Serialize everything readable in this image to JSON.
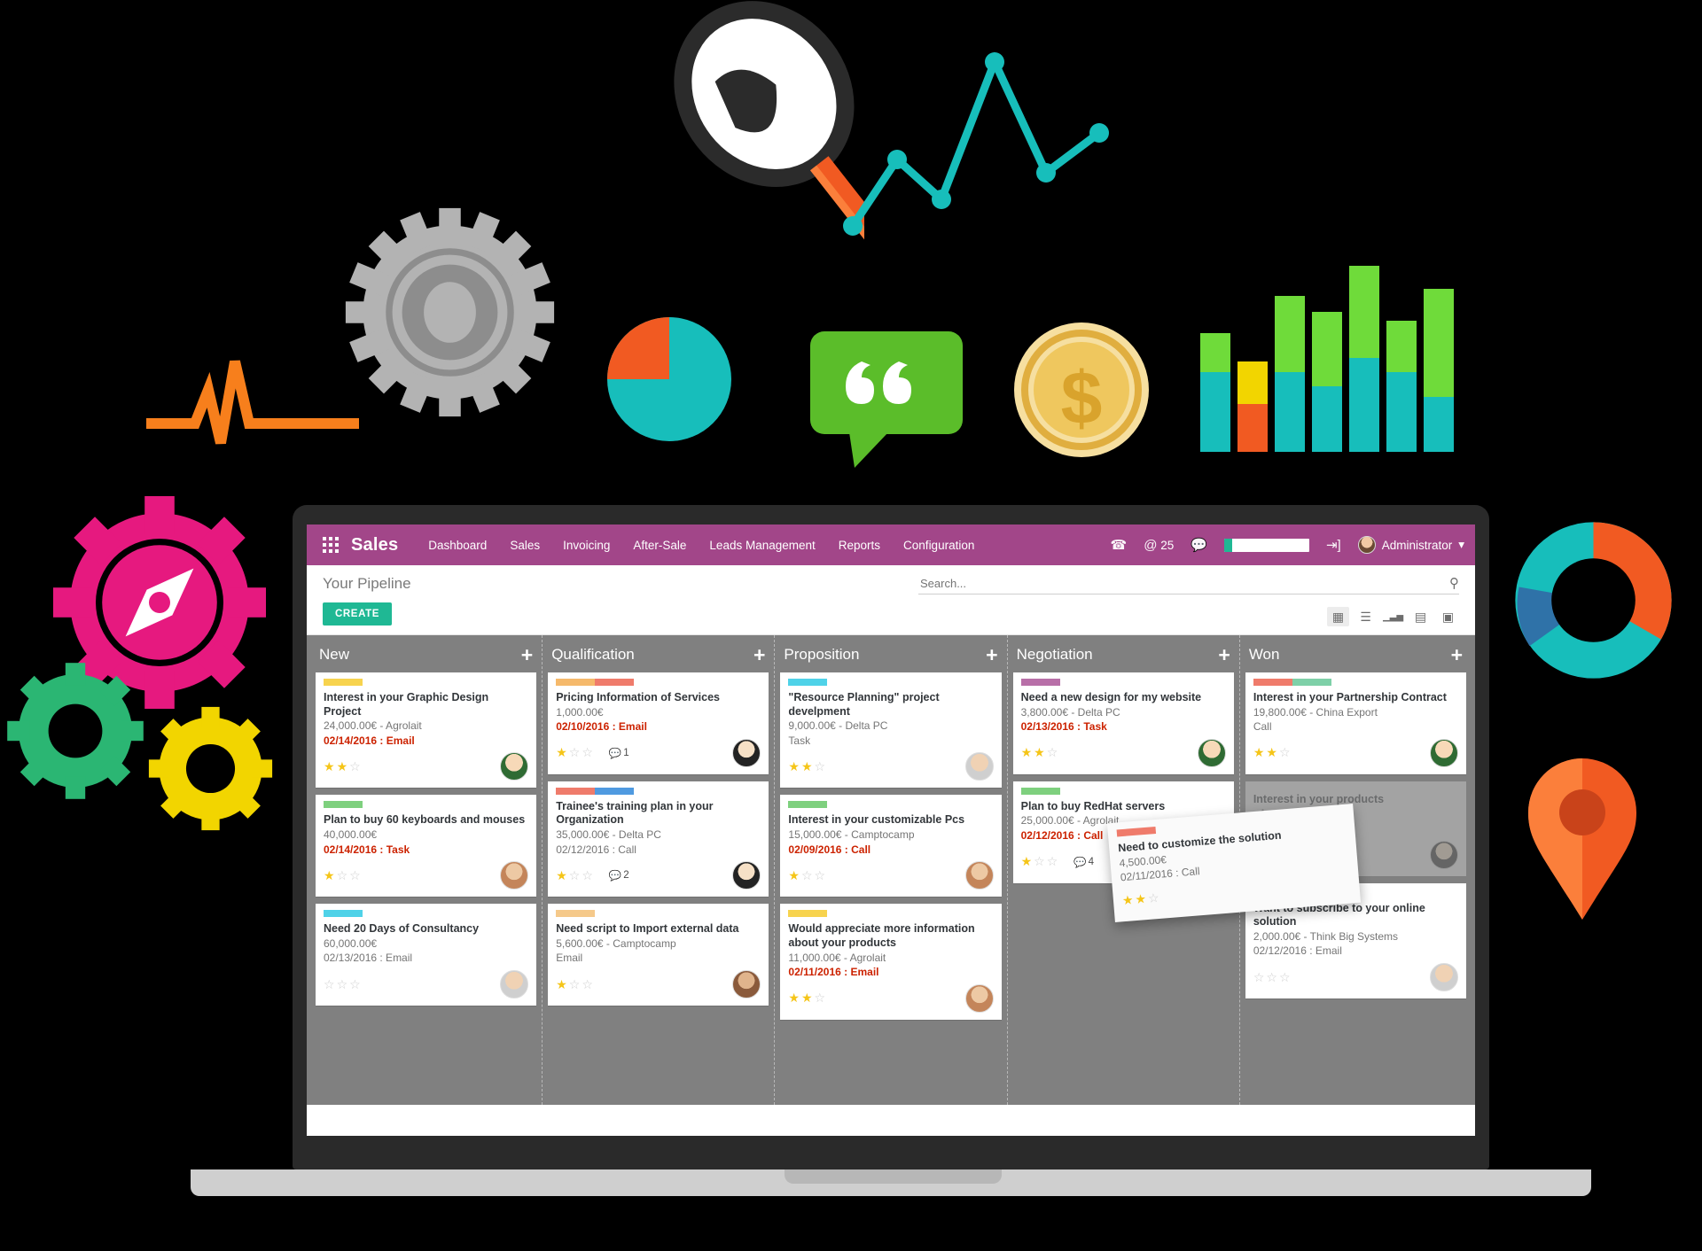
{
  "app": {
    "brand": "Sales",
    "apps_icon": "apps-grid-icon",
    "menu": [
      "Dashboard",
      "Sales",
      "Invoicing",
      "After-Sale",
      "Leads Management",
      "Reports",
      "Configuration"
    ],
    "nav_right": {
      "phone_icon": "phone-icon",
      "mention_icon": "at-icon",
      "mention_count": "25",
      "chat_icon": "chat-bubble-icon",
      "progress_percent": 9,
      "logout_icon": "sign-in-icon",
      "user_name": "Administrator",
      "caret": "▾"
    },
    "accent_color": "#a24689",
    "create_color": "#1fb894"
  },
  "control_panel": {
    "title": "Your Pipeline",
    "create_label": "CREATE",
    "search_placeholder": "Search...",
    "search_value": "",
    "search_icon": "search-icon",
    "views": [
      {
        "name": "kanban",
        "glyph": "▦",
        "active": true
      },
      {
        "name": "list",
        "glyph": "☰",
        "active": false
      },
      {
        "name": "graph",
        "glyph": "▁▃▅",
        "active": false
      },
      {
        "name": "pivot",
        "glyph": "▤",
        "active": false
      },
      {
        "name": "calendar",
        "glyph": "▣",
        "active": false
      }
    ]
  },
  "kanban": {
    "columns": [
      {
        "title": "New",
        "add_label": "+",
        "cards": [
          {
            "tags": [
              "#f7d34e"
            ],
            "title": "Interest in your Graphic Design Project",
            "subtitle": "24,000.00€ - Agrolait",
            "date": "02/14/2016 : Email",
            "date_urgent": true,
            "stars": 2,
            "messages": null,
            "avatar": "w1"
          },
          {
            "tags": [
              "#7ed07e"
            ],
            "title": "Plan to buy 60 keyboards and mouses",
            "subtitle": "40,000.00€",
            "date": "02/14/2016 : Task",
            "date_urgent": true,
            "stars": 1,
            "messages": null,
            "avatar": "m3"
          },
          {
            "tags": [
              "#4fd2e8"
            ],
            "title": "Need 20 Days of Consultancy",
            "subtitle": "60,000.00€",
            "date": "02/13/2016 : Email",
            "date_urgent": false,
            "stars": 0,
            "messages": null,
            "avatar": "m2"
          }
        ]
      },
      {
        "title": "Qualification",
        "add_label": "+",
        "cards": [
          {
            "tags": [
              "#f5b96b",
              "#ef7b6b"
            ],
            "title": "Pricing Information of Services",
            "subtitle": "1,000.00€",
            "date": "02/10/2016 : Email",
            "date_urgent": true,
            "stars": 1,
            "messages": "1",
            "avatar": "w3"
          },
          {
            "tags": [
              "#ef7b6b",
              "#4f9ae0"
            ],
            "title": "Trainee's training plan in your Organization",
            "subtitle": "35,000.00€ - Delta PC",
            "date": "02/12/2016 : Call",
            "date_urgent": false,
            "stars": 1,
            "messages": "2",
            "avatar": "w3"
          },
          {
            "tags": [
              "#f5c98a"
            ],
            "title": "Need script to Import external data",
            "subtitle": "5,600.00€ - Camptocamp",
            "date": "Email",
            "date_urgent": false,
            "stars": 1,
            "messages": null,
            "avatar": "m1"
          }
        ]
      },
      {
        "title": "Proposition",
        "add_label": "+",
        "cards": [
          {
            "tags": [
              "#4fd2e8"
            ],
            "title": "\"Resource Planning\" project develpment",
            "subtitle": "9,000.00€ - Delta PC",
            "date": "Task",
            "date_urgent": false,
            "stars": 2,
            "messages": null,
            "avatar": "m2"
          },
          {
            "tags": [
              "#7ed07e"
            ],
            "title": "Interest in your customizable Pcs",
            "subtitle": "15,000.00€ - Camptocamp",
            "date": "02/09/2016 : Call",
            "date_urgent": true,
            "stars": 1,
            "messages": null,
            "avatar": "m3"
          },
          {
            "tags": [
              "#f7d34e"
            ],
            "title": "Would appreciate more information about your products",
            "subtitle": "11,000.00€ - Agrolait",
            "date": "02/11/2016 : Email",
            "date_urgent": true,
            "stars": 2,
            "messages": null,
            "avatar": "m3"
          }
        ]
      },
      {
        "title": "Negotiation",
        "add_label": "+",
        "cards": [
          {
            "tags": [
              "#b86fa8"
            ],
            "title": "Need a new design for my website",
            "subtitle": "3,800.00€ - Delta PC",
            "date": "02/13/2016 : Task",
            "date_urgent": true,
            "stars": 2,
            "messages": null,
            "avatar": "w1"
          },
          {
            "tags": [
              "#7ed07e"
            ],
            "title": "Plan to buy RedHat servers",
            "subtitle": "25,000.00€ - Agrolait",
            "date": "02/12/2016 : Call",
            "date_urgent": true,
            "stars": 1,
            "messages": "4",
            "avatar": "m4"
          }
        ]
      },
      {
        "title": "Won",
        "add_label": "+",
        "cards": [
          {
            "tags": [
              "#ef7b6b",
              "#7ed0a8"
            ],
            "title": "Interest in your Partnership Contract",
            "subtitle": "19,800.00€ - China Export",
            "date": "Call",
            "date_urgent": false,
            "stars": 2,
            "messages": null,
            "avatar": "w1"
          },
          {
            "tags": [],
            "title": "Interest in your products",
            "subtitle": "- Agrolait",
            "date": "02/11/2016 : Email",
            "date_urgent": true,
            "stars": 2,
            "messages": null,
            "avatar": "w3",
            "ghost": true
          },
          {
            "tags": [
              "#f5c98a"
            ],
            "title": "Want to subscribe to your online solution",
            "subtitle": "2,000.00€ - Think Big Systems",
            "date": "02/12/2016 : Email",
            "date_urgent": false,
            "stars": 0,
            "messages": null,
            "avatar": "m2"
          }
        ]
      }
    ],
    "dragged_card": {
      "tags": [
        "#ef7b6b"
      ],
      "title": "Need to customize the solution",
      "subtitle": "4,500.00€",
      "date": "02/11/2016 : Call",
      "date_urgent": false,
      "stars": 2
    }
  },
  "decorations": {
    "items": [
      {
        "name": "pulse-line-icon",
        "color": "#f77f1c"
      },
      {
        "name": "grey-gear-icon",
        "color": "#b3b3b3"
      },
      {
        "name": "magnifier-icon",
        "color": "#f15a22"
      },
      {
        "name": "line-chart-icon",
        "color": "#17bebb"
      },
      {
        "name": "pie-chart-icon",
        "color": "#17bebb"
      },
      {
        "name": "speech-bubble-icon",
        "color": "#5bbd2a"
      },
      {
        "name": "dollar-coin-icon",
        "color": "#efc75e"
      },
      {
        "name": "bar-chart-icon",
        "color": "#6fdb3a"
      },
      {
        "name": "pink-compass-gear-icon",
        "color": "#e6197f"
      },
      {
        "name": "green-gear-icon",
        "color": "#2bb673"
      },
      {
        "name": "yellow-gear-icon",
        "color": "#f2d500"
      },
      {
        "name": "donut-chart-icon",
        "color": "#17bebb"
      },
      {
        "name": "map-pin-icon",
        "color": "#f15a22"
      }
    ]
  }
}
